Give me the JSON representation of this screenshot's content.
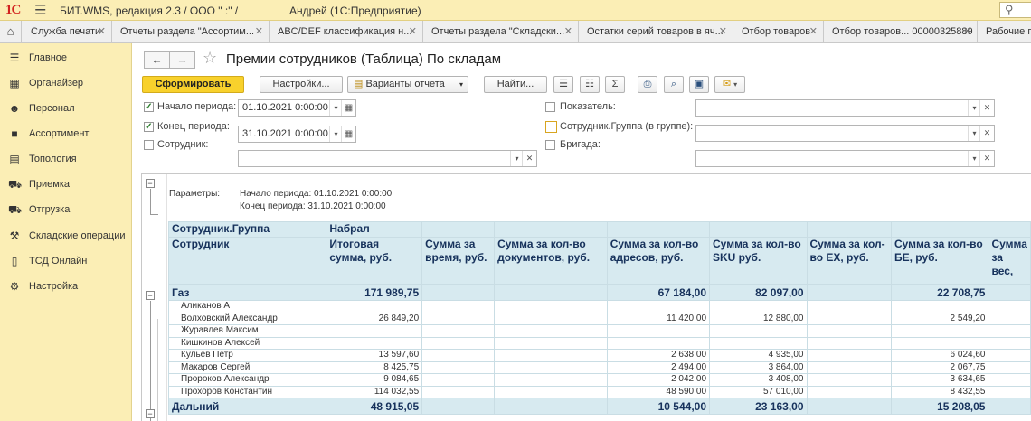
{
  "titlebar": {
    "logo": "1С",
    "title": "БИТ.WMS, редакция 2.3 / ООО \"            :\" /",
    "user": "Андрей  (1С:Предприятие)",
    "search_icon": "search-icon"
  },
  "tabs": [
    {
      "label": "Служба печати"
    },
    {
      "label": "Отчеты раздела \"Ассортим..."
    },
    {
      "label": "ABC/DEF классификация н..."
    },
    {
      "label": "Отчеты раздела \"Складски..."
    },
    {
      "label": "Остатки серий товаров в яч..."
    },
    {
      "label": "Отбор товаров"
    },
    {
      "label": "Отбор товаров... 00000325889"
    },
    {
      "label": "Рабочие п"
    }
  ],
  "sidebar": {
    "items": [
      {
        "label": "Главное",
        "icon": "menu-icon"
      },
      {
        "label": "Органайзер",
        "icon": "calendar-icon"
      },
      {
        "label": "Персонал",
        "icon": "people-icon"
      },
      {
        "label": "Ассортимент",
        "icon": "box-icon"
      },
      {
        "label": "Топология",
        "icon": "warehouse-icon"
      },
      {
        "label": "Приемка",
        "icon": "truck-in-icon"
      },
      {
        "label": "Отгрузка",
        "icon": "truck-out-icon"
      },
      {
        "label": "Складские операции",
        "icon": "forklift-icon"
      },
      {
        "label": "ТСД Онлайн",
        "icon": "scanner-icon"
      },
      {
        "label": "Настройка",
        "icon": "settings-icon"
      }
    ]
  },
  "form": {
    "title": "Премии сотрудников (Таблица) По складам",
    "back": "←",
    "forward": "→",
    "generate": "Сформировать",
    "settings": "Настройки...",
    "variants": "Варианты отчета",
    "find": "Найти..."
  },
  "filters": {
    "period_start": {
      "label": "Начало периода:",
      "value": "01.10.2021  0:00:00",
      "checked": true
    },
    "period_end": {
      "label": "Конец периода:",
      "value": "31.10.2021  0:00:00",
      "checked": true
    },
    "employee": {
      "label": "Сотрудник:",
      "value": "",
      "checked": false
    },
    "indicator": {
      "label": "Показатель:",
      "value": "",
      "checked": false
    },
    "employee_group": {
      "label": "Сотрудник.Группа (в группе):",
      "value": "",
      "checked": false
    },
    "brigade": {
      "label": "Бригада:",
      "value": "",
      "checked": false
    }
  },
  "report": {
    "params_label": "Параметры:",
    "param_start": "Начало периода: 01.10.2021 0:00:00",
    "param_end": "Конец периода: 31.10.2021 0:00:00",
    "header_row1": [
      "Сотрудник.Группа",
      "Набрал",
      "",
      "",
      "",
      "",
      "",
      "",
      ""
    ],
    "header_row2": [
      "Сотрудник",
      "Итоговая сумма, руб.",
      "Сумма за время, руб.",
      "Сумма за кол-во документов, руб.",
      "Сумма за кол-во адресов, руб.",
      "Сумма за кол-во SKU руб.",
      "Сумма за кол-во ЕХ, руб.",
      "Сумма за кол-во БЕ, руб.",
      "Сумма за вес,"
    ],
    "group1": {
      "name": "Газ",
      "values": [
        "171 989,75",
        "",
        "",
        "67 184,00",
        "82 097,00",
        "",
        "22 708,75",
        ""
      ]
    },
    "rows": [
      {
        "name": "Аликанов А",
        "values": [
          "",
          "",
          "",
          "",
          "",
          "",
          "",
          ""
        ]
      },
      {
        "name": "Волховский Александр",
        "values": [
          "26 849,20",
          "",
          "",
          "11 420,00",
          "12 880,00",
          "",
          "2 549,20",
          ""
        ]
      },
      {
        "name": "Журавлев Максим",
        "values": [
          "",
          "",
          "",
          "",
          "",
          "",
          "",
          ""
        ]
      },
      {
        "name": "Кишкинов Алексей",
        "values": [
          "",
          "",
          "",
          "",
          "",
          "",
          "",
          ""
        ]
      },
      {
        "name": "Кульев Петр",
        "values": [
          "13 597,60",
          "",
          "",
          "2 638,00",
          "4 935,00",
          "",
          "6 024,60",
          ""
        ]
      },
      {
        "name": "Макаров Сергей",
        "values": [
          "8 425,75",
          "",
          "",
          "2 494,00",
          "3 864,00",
          "",
          "2 067,75",
          ""
        ]
      },
      {
        "name": "Пророков Александр",
        "values": [
          "9 084,65",
          "",
          "",
          "2 042,00",
          "3 408,00",
          "",
          "3 634,65",
          ""
        ]
      },
      {
        "name": "Прохоров Константин",
        "values": [
          "114 032,55",
          "",
          "",
          "48 590,00",
          "57 010,00",
          "",
          "8 432,55",
          ""
        ]
      }
    ],
    "group2": {
      "name": "Дальний",
      "values": [
        "48 915,05",
        "",
        "",
        "10 544,00",
        "23 163,00",
        "",
        "15 208,05",
        ""
      ]
    }
  }
}
